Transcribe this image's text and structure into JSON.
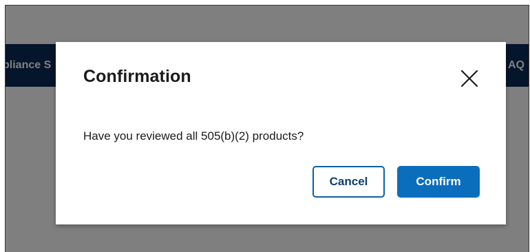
{
  "navbar": {
    "left_text": "pliance S",
    "right_text": "AQ"
  },
  "dialog": {
    "title": "Confirmation",
    "message": "Have you reviewed all 505(b)(2) products?",
    "cancel_label": "Cancel",
    "confirm_label": "Confirm",
    "close_icon": "close-icon"
  },
  "colors": {
    "navbar_bg": "#0b2a57",
    "overlay": "rgba(0,0,0,0.5)",
    "primary": "#0b6ebd",
    "cancel_border": "#0b5fa5",
    "cancel_text": "#0b3f70"
  }
}
